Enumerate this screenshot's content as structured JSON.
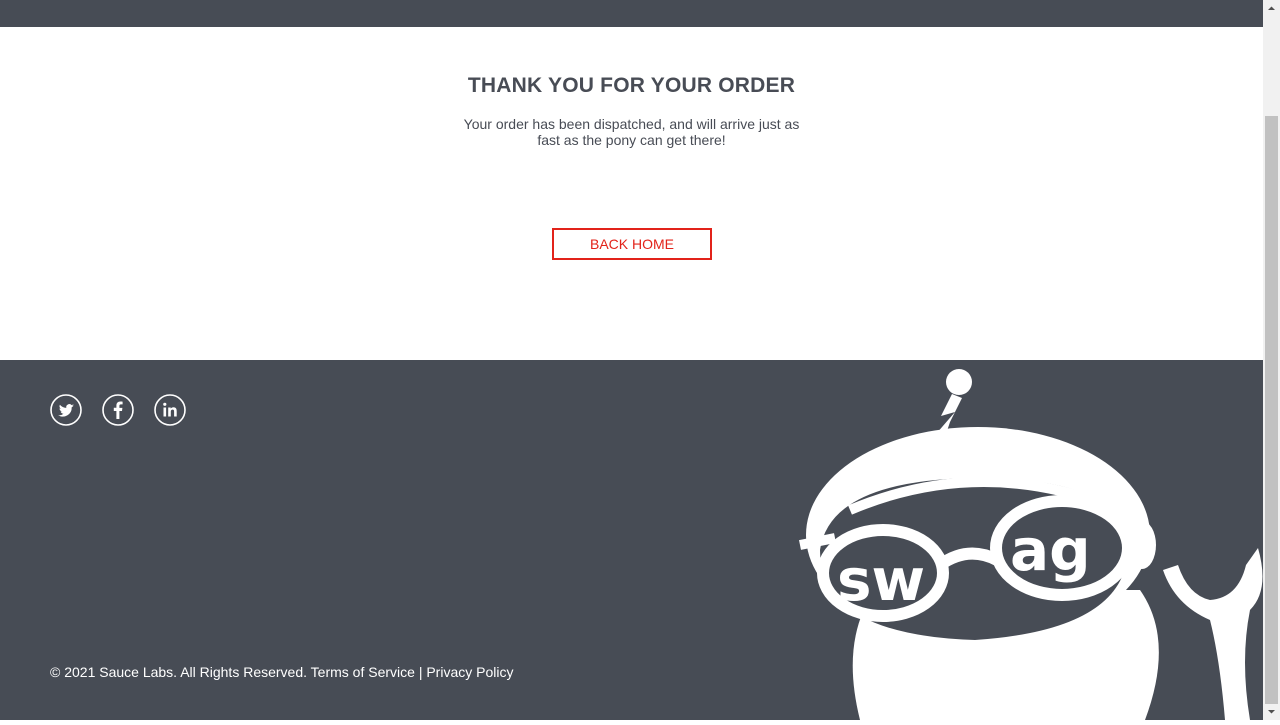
{
  "checkout": {
    "title": "THANK YOU FOR YOUR ORDER",
    "message": "Your order has been dispatched, and will arrive just as fast as the pony can get there!",
    "back_button_label": "BACK HOME"
  },
  "footer": {
    "social": [
      {
        "name": "Twitter",
        "icon": "twitter-icon"
      },
      {
        "name": "Facebook",
        "icon": "facebook-icon"
      },
      {
        "name": "LinkedIn",
        "icon": "linkedin-icon"
      }
    ],
    "copyright": "© 2021 Sauce Labs. All Rights Reserved.",
    "terms_label": "Terms of Service",
    "separator": "|",
    "privacy_label": "Privacy Policy",
    "mascot_text": "swag"
  },
  "colors": {
    "header_bg": "#474c55",
    "footer_bg": "#474c55",
    "accent": "#e2231a",
    "text": "#484c55"
  }
}
